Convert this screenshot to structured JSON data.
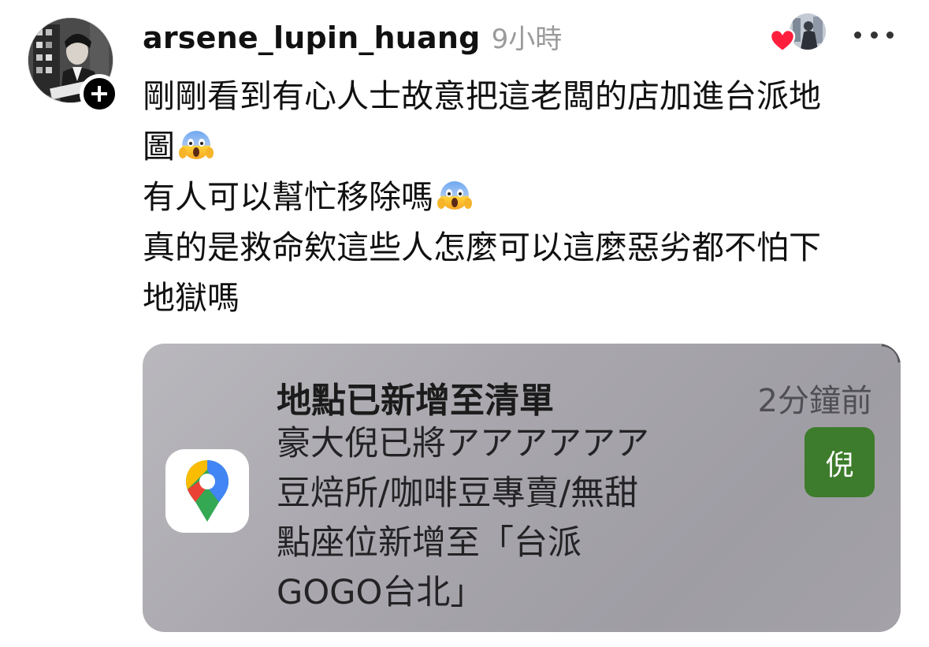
{
  "post": {
    "username": "arsene_lupin_huang",
    "timestamp": "9小時",
    "follow_badge": "+",
    "lines": [
      "剛剛看到有心人士故意把這老闆的店加進台派地",
      "圖",
      "有人可以幫忙移除嗎",
      "真的是救命欸這些人怎麼可以這麼惡劣都不怕下",
      "地獄嗎"
    ],
    "emojis": [
      "face-screaming-in-fear",
      "face-screaming-in-fear"
    ]
  },
  "notification": {
    "app_icon": "google-maps-icon",
    "title": "地點已新增至清單",
    "time": "2分鐘前",
    "body_lines": [
      "豪大倪已將アアアアアア",
      "豆焙所/咖啡豆專賣/無甜",
      "點座位新增至「台派",
      "GOGO台北」"
    ],
    "thumbnail_text": "倪",
    "thumbnail_color": "#3d7c2c"
  },
  "colors": {
    "like_heart": "#ff1f3d",
    "timestamp_gray": "#9a9a9a",
    "card_background": "#a9a7ad"
  }
}
